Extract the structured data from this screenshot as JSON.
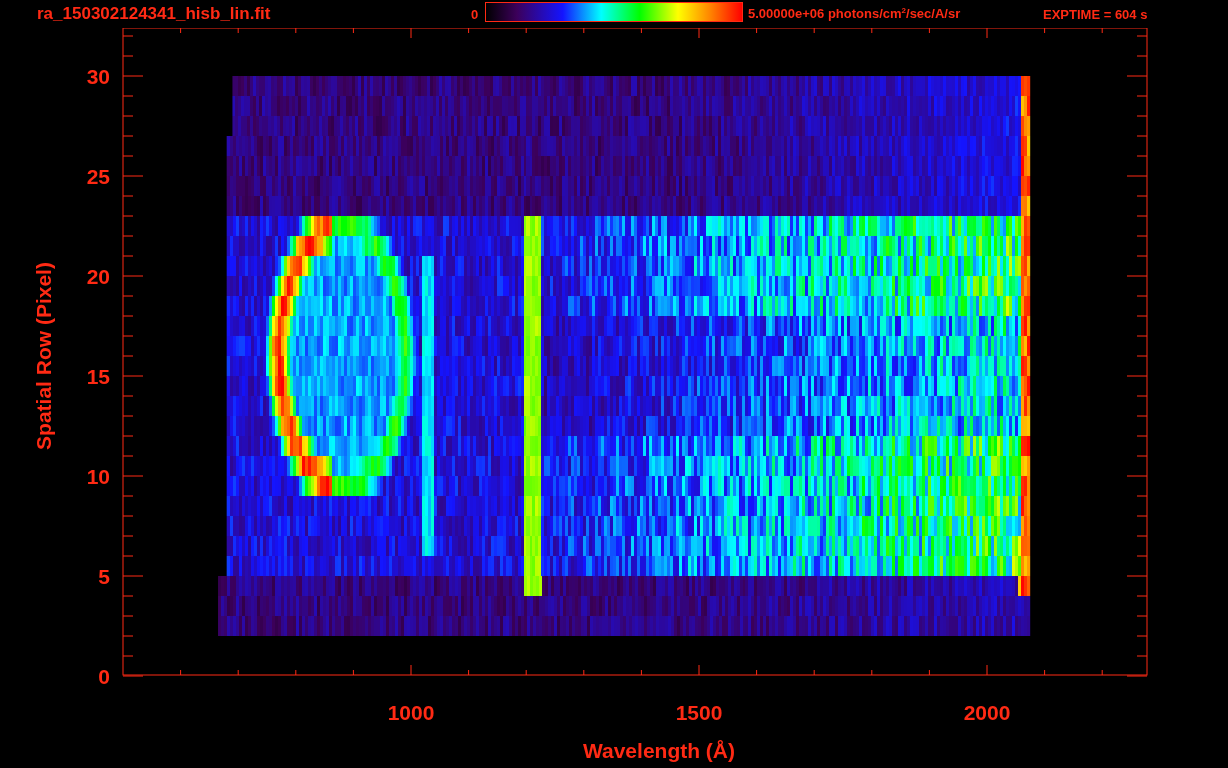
{
  "title": "ra_150302124341_hisb_lin.fit",
  "colorbar": {
    "min_label": "0",
    "max_label": "5.00000e+06 photons/cm$^{2}$/sec/A/sr"
  },
  "exposure": "EXPTIME = 604 s",
  "plot": {
    "xlabel": "Wavelength (Å)",
    "ylabel": "Spatial Row (Pixel)",
    "xtick_labels": [
      "1000",
      "1500",
      "2000"
    ],
    "ytick_labels": [
      "30",
      "25",
      "20",
      "15",
      "10",
      "5",
      "0"
    ]
  }
}
